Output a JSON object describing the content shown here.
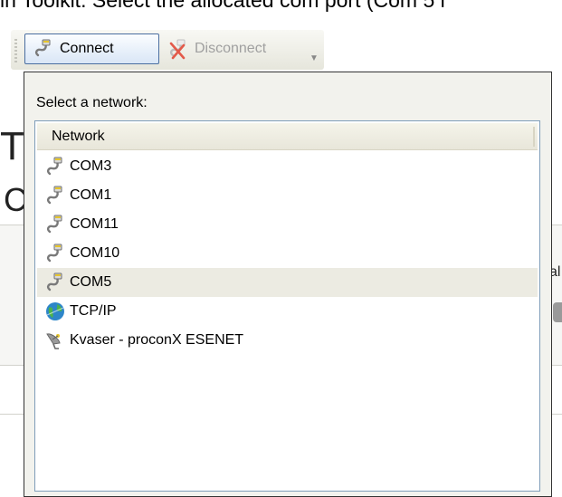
{
  "caption": "in Toolkit. Select the allocated com port (Com 5 i",
  "background": {
    "fragment_1": "T",
    "fragment_2": "C",
    "fragment_3": "al"
  },
  "toolbar": {
    "connect_label": "Connect",
    "disconnect_label": "Disconnect",
    "overflow_icon": "chevron-down-icon"
  },
  "network_popup": {
    "prompt": "Select a network:",
    "column_header": "Network",
    "selected": "COM5",
    "items": [
      {
        "label": "COM3",
        "icon": "serial-cable-icon"
      },
      {
        "label": "COM1",
        "icon": "serial-cable-icon"
      },
      {
        "label": "COM11",
        "icon": "serial-cable-icon"
      },
      {
        "label": "COM10",
        "icon": "serial-cable-icon"
      },
      {
        "label": "COM5",
        "icon": "serial-cable-icon"
      },
      {
        "label": "TCP/IP",
        "icon": "globe-network-icon"
      },
      {
        "label": "Kvaser - proconX ESENET",
        "icon": "satellite-dish-icon"
      }
    ]
  },
  "colors": {
    "selection_highlight": "#ecebe2",
    "listbox_border": "#7f9db9",
    "connect_button_border": "#4a6ea0"
  }
}
